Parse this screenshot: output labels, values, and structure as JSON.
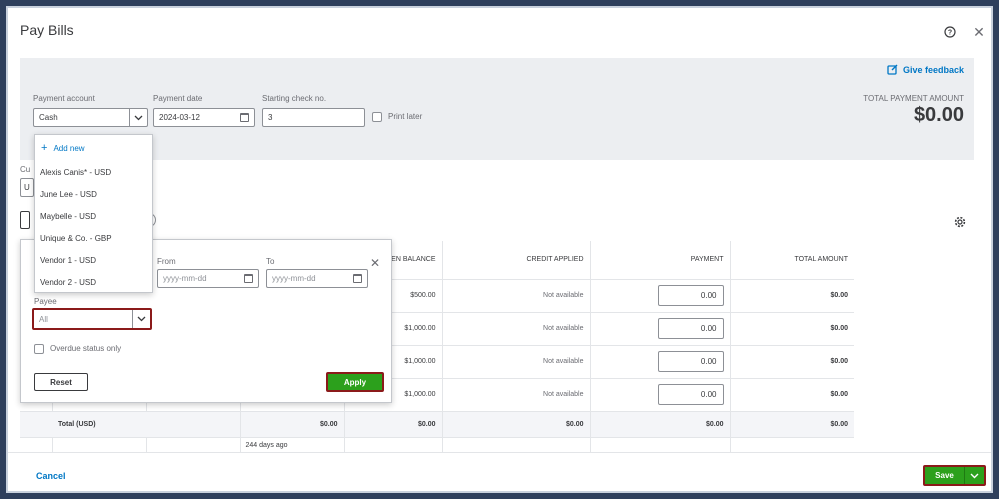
{
  "dialog": {
    "title": "Pay Bills",
    "help_icon": "help-circle-icon",
    "close_icon": "close-icon"
  },
  "header": {
    "feedback_label": "Give feedback",
    "payment_account": {
      "label": "Payment account",
      "value": "Cash"
    },
    "payment_date": {
      "label": "Payment date",
      "value": "2024-03-12"
    },
    "starting_check": {
      "label": "Starting check no.",
      "value": "3"
    },
    "print_later": {
      "label": "Print later",
      "checked": false
    },
    "total_payment_label": "TOTAL PAYMENT AMOUNT",
    "total_payment_value": "$0.00"
  },
  "behind_labels": {
    "currency_stub": "Cu",
    "currency_field_stub": "U"
  },
  "account_dropdown": {
    "add_new": "Add new",
    "items": [
      "Alexis Canis* - USD",
      "June Lee - USD",
      "Maybelle - USD",
      "Unique & Co. - GBP",
      "Vendor 1 - USD",
      "Vendor 2 - USD"
    ]
  },
  "filter": {
    "from_label": "From",
    "to_label": "To",
    "from_placeholder": "yyyy-mm-dd",
    "to_placeholder": "yyyy-mm-dd",
    "payee_label": "Payee",
    "payee_value": "All",
    "overdue_label": "Overdue status only",
    "reset_label": "Reset",
    "apply_label": "Apply"
  },
  "table": {
    "columns": [
      "OPEN BALANCE",
      "CREDIT APPLIED",
      "PAYMENT",
      "TOTAL AMOUNT"
    ],
    "rows": [
      {
        "open_balance": "$500.00",
        "credit": "Not available",
        "payment": "0.00",
        "total": "$0.00"
      },
      {
        "open_balance": "$1,000.00",
        "credit": "Not available",
        "payment": "0.00",
        "total": "$0.00"
      },
      {
        "open_balance": "$1,000.00",
        "credit": "Not available",
        "payment": "0.00",
        "total": "$0.00"
      },
      {
        "open_balance": "$1,000.00",
        "credit": "Not available",
        "payment": "0.00",
        "total": "$0.00"
      }
    ],
    "total_row": {
      "label": "Total (USD)",
      "due": "$0.00",
      "open_balance": "$0.00",
      "credit": "$0.00",
      "payment": "$0.00",
      "total": "$0.00"
    },
    "below_text": "244 days ago"
  },
  "footer": {
    "cancel_label": "Cancel",
    "save_label": "Save"
  }
}
